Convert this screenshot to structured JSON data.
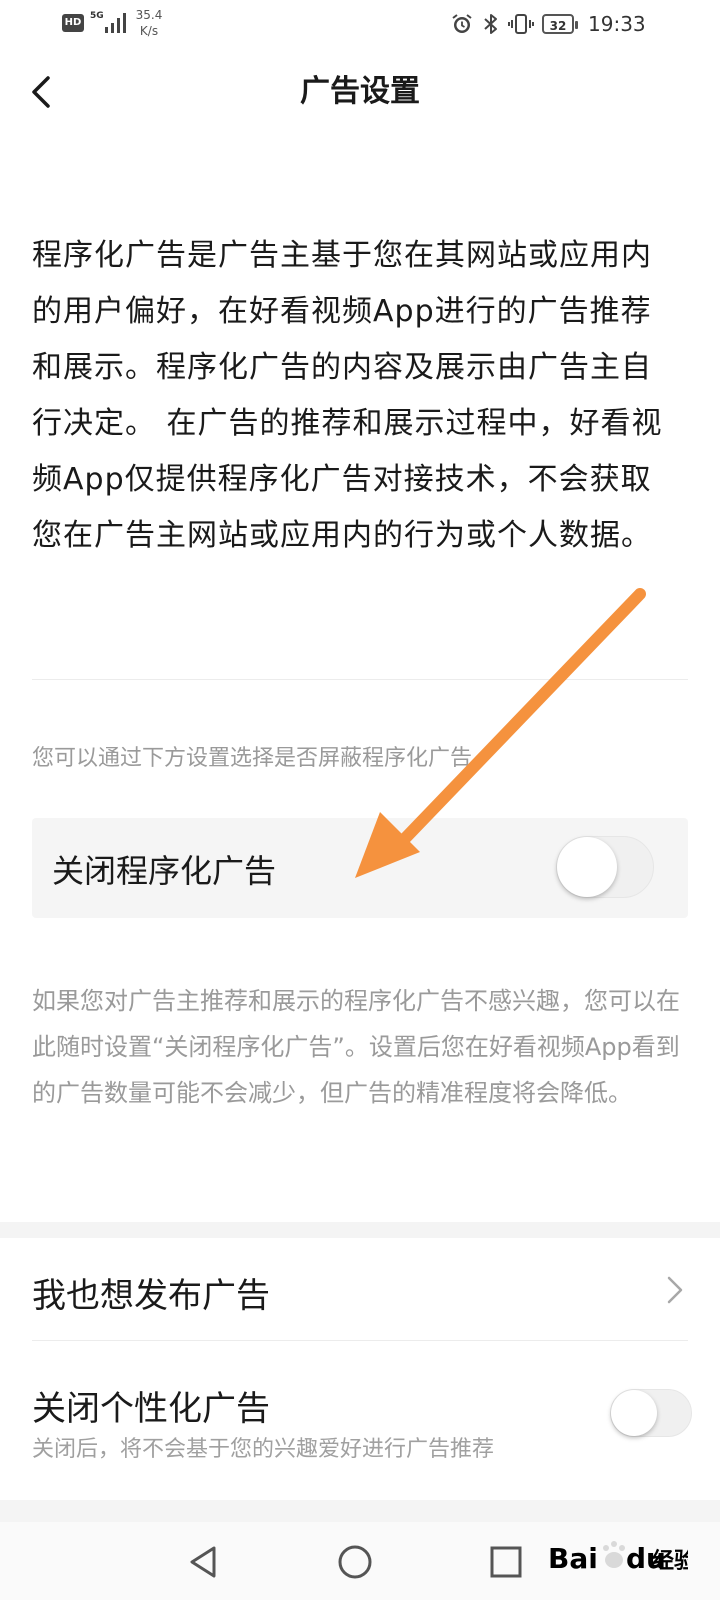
{
  "status_bar": {
    "hd": "HD",
    "network": "5G",
    "speed_value": "35.4",
    "speed_unit": "K/s",
    "battery": "32",
    "time": "19:33",
    "icons": [
      "alarm-icon",
      "bluetooth-icon",
      "vibrate-icon",
      "battery-icon"
    ]
  },
  "header": {
    "title": "广告设置",
    "back_icon": "chevron-left-icon"
  },
  "intro": {
    "text": "程序化广告是广告主基于您在其网站或应用内的用户偏好，在好看视频App进行的广告推荐和展示。程序化广告的内容及展示由广告主自行决定。 在广告的推荐和展示过程中，好看视频App仅提供程序化广告对接技术，不会获取您在广告主网站或应用内的行为或个人数据。"
  },
  "hint": "您可以通过下方设置选择是否屏蔽程序化广告。",
  "programmatic_toggle": {
    "label": "关闭程序化广告",
    "enabled": false
  },
  "description": "如果您对广告主推荐和展示的程序化广告不感兴趣，您可以在此随时设置“关闭程序化广告”。设置后您在好看视频App看到的广告数量可能不会减少，但广告的精准程度将会降低。",
  "publish_row": {
    "label": "我也想发布广告",
    "icon": "chevron-right-icon"
  },
  "personalized_toggle": {
    "label": "关闭个性化广告",
    "sublabel": "关闭后，将不会基于您的兴趣爱好进行广告推荐",
    "enabled": false
  },
  "nav_bar": {
    "icons": [
      "back-triangle-icon",
      "home-circle-icon",
      "recents-square-icon"
    ]
  },
  "annotation": {
    "arrow_color": "#f5923e"
  },
  "watermark": {
    "text": "Bai",
    "text2": "du",
    "suffix": "经验"
  },
  "colors": {
    "accent_arrow": "#f5923e",
    "text_primary": "#1a1a1a",
    "text_secondary": "#9a9a9a",
    "row_bg": "#f5f5f5"
  }
}
